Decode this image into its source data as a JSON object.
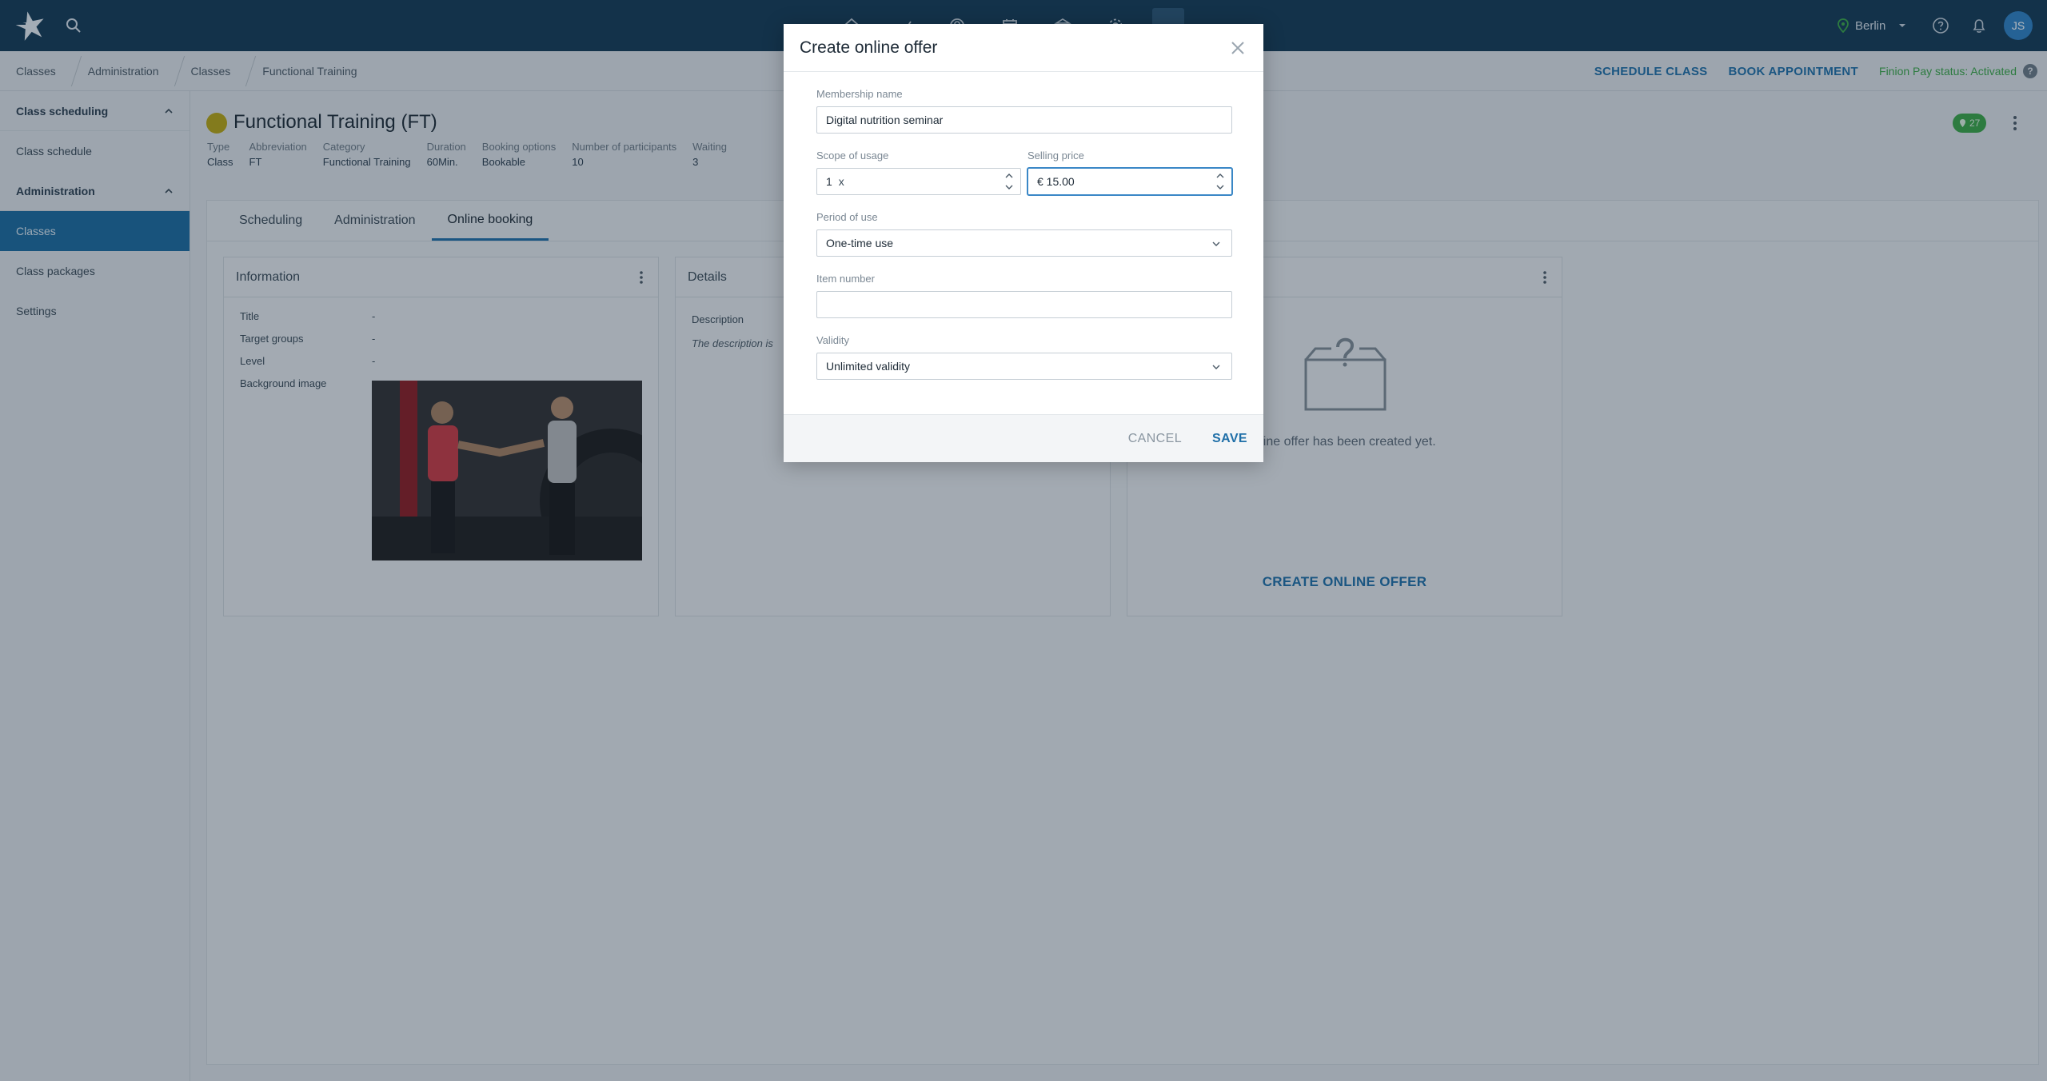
{
  "topbar": {
    "location": "Berlin",
    "avatar_initials": "JS",
    "nav_icons": [
      "home-icon",
      "check-in-icon",
      "member-icon",
      "calendar-icon",
      "bank-icon",
      "settings-icon",
      "more-icon"
    ]
  },
  "breadcrumb": {
    "items": [
      "Classes",
      "Administration",
      "Classes",
      "Functional Training"
    ],
    "actions": {
      "schedule": "SCHEDULE CLASS",
      "book": "BOOK APPOINTMENT"
    },
    "pay_status": "Finion Pay status: Activated",
    "help": "?"
  },
  "sidebar": {
    "sections": [
      {
        "label": "Class scheduling",
        "items": [
          "Class schedule"
        ]
      },
      {
        "label": "Administration",
        "items": [
          "Classes",
          "Class packages",
          "Settings"
        ],
        "active": "Classes"
      }
    ]
  },
  "page": {
    "title": "Functional Training (FT)",
    "badge_count": "27",
    "meta": [
      {
        "key": "Type",
        "value": "Class"
      },
      {
        "key": "Abbreviation",
        "value": "FT"
      },
      {
        "key": "Category",
        "value": "Functional Training"
      },
      {
        "key": "Duration",
        "value": "60Min."
      },
      {
        "key": "Booking options",
        "value": "Bookable"
      },
      {
        "key": "Number of participants",
        "value": "10"
      },
      {
        "key": "Waiting",
        "value": "3"
      }
    ],
    "tabs": [
      "Scheduling",
      "Administration",
      "Online booking"
    ],
    "active_tab": "Online booking"
  },
  "cards": {
    "information": {
      "title": "Information",
      "rows": [
        {
          "key": "Title",
          "value": "-"
        },
        {
          "key": "Target groups",
          "value": "-"
        },
        {
          "key": "Level",
          "value": "-"
        },
        {
          "key": "Background image",
          "value": ""
        }
      ]
    },
    "details": {
      "title": "Details",
      "description_label": "Description",
      "description_text": "The description is"
    },
    "online_offer": {
      "empty_text": "nline offer has been created yet.",
      "create_label": "CREATE ONLINE OFFER"
    }
  },
  "modal": {
    "title": "Create online offer",
    "membership_name": {
      "label": "Membership name",
      "value": "Digital nutrition seminar"
    },
    "scope": {
      "label": "Scope of usage",
      "value": "1",
      "unit": "x"
    },
    "price": {
      "label": "Selling price",
      "value": "€ 15.00"
    },
    "period": {
      "label": "Period of use",
      "value": "One-time use"
    },
    "item_number": {
      "label": "Item number",
      "value": ""
    },
    "validity": {
      "label": "Validity",
      "value": "Unlimited validity"
    },
    "cancel": "CANCEL",
    "save": "SAVE"
  },
  "colors": {
    "topbar": "#143a56",
    "accent": "#1f6fa8",
    "active_sidebar": "#1b6aa0",
    "success": "#3aa648",
    "class_dot": "#b8a514"
  }
}
